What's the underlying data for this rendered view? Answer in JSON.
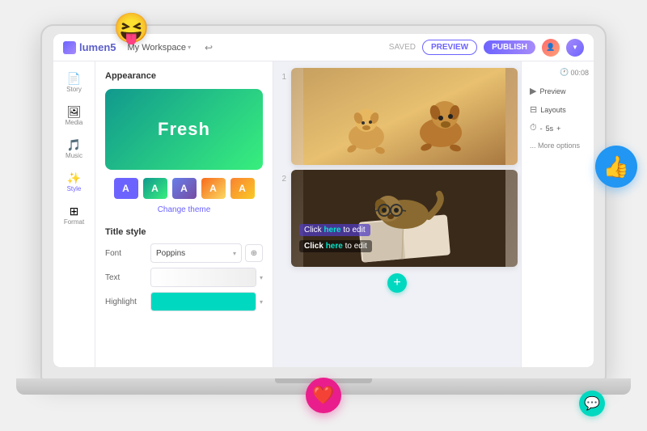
{
  "app": {
    "logo": "lumen5",
    "workspace": "My Workspace",
    "saved_label": "SAVED",
    "preview_label": "PREVIEW",
    "publish_label": "PUBLISH",
    "timer": "00:08"
  },
  "sidebar": {
    "items": [
      {
        "id": "story",
        "label": "Story",
        "icon": "📄"
      },
      {
        "id": "media",
        "label": "Media",
        "icon": "🖼"
      },
      {
        "id": "music",
        "label": "Music",
        "icon": "🎵"
      },
      {
        "id": "style",
        "label": "Style",
        "icon": "✨"
      },
      {
        "id": "format",
        "label": "Format",
        "icon": "⊞"
      }
    ]
  },
  "panel": {
    "appearance_title": "Appearance",
    "theme_text": "Fresh",
    "change_theme": "Change theme",
    "title_style": "Title style",
    "font_label": "Font",
    "font_value": "Poppins",
    "text_label": "Text",
    "highlight_label": "Highlight",
    "swatches": [
      {
        "color": "#6c63ff",
        "label": "A"
      },
      {
        "color": "#11998e",
        "label": "A"
      },
      {
        "color": "#667eea",
        "label": "A"
      },
      {
        "color": "#f76b1c",
        "label": "A"
      },
      {
        "color": "#fa8231",
        "label": "A"
      }
    ]
  },
  "canvas": {
    "slide1": {
      "number": "1"
    },
    "slide2": {
      "number": "2"
    },
    "click_text_1": "Click here to edit",
    "click_text_2": "Click here to edit",
    "add_slide": "+"
  },
  "right_panel": {
    "preview_label": "Preview",
    "layouts_label": "Layouts",
    "duration_label": "5s",
    "more_options": "... More options"
  },
  "floating": {
    "emoji": "😝",
    "thumbsup": "👍",
    "heart": "❤️"
  }
}
